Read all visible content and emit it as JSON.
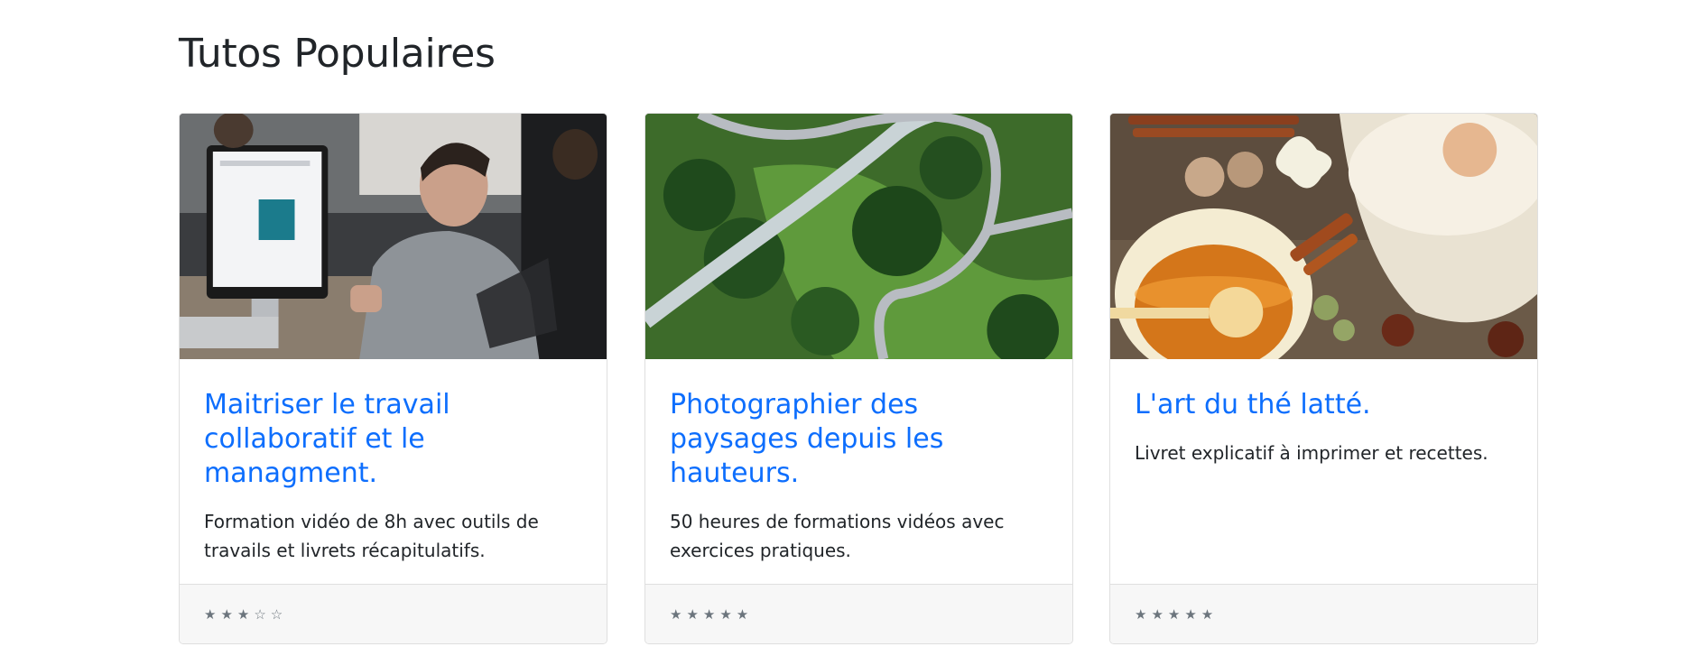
{
  "section": {
    "title": "Tutos Populaires"
  },
  "cards": [
    {
      "image": "office-coworking-photo",
      "title": "Maitriser le travail collaboratif et le managment.",
      "description": "Formation vidéo de 8h avec outils de travails et livrets récapitulatifs.",
      "rating_text": "★★★☆☆",
      "rating": 3,
      "rating_max": 5
    },
    {
      "image": "aerial-landscape-photo",
      "title": "Photographier des paysages depuis les hauteurs.",
      "description": "50 heures de formations vidéos avec exercices pratiques.",
      "rating_text": "★★★★★",
      "rating": 5,
      "rating_max": 5
    },
    {
      "image": "chai-latte-photo",
      "title": "L'art du thé latté.",
      "description": "Livret explicatif à imprimer et recettes.",
      "rating_text": "★★★★★",
      "rating": 5,
      "rating_max": 5
    }
  ],
  "colors": {
    "link": "#0d6efd",
    "text": "#212529",
    "footer_bg": "#f7f7f7",
    "border": "#dfdfdf",
    "stars": "#6c757d"
  }
}
